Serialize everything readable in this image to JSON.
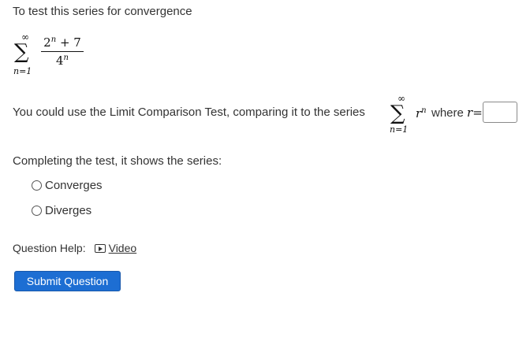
{
  "question": {
    "intro": "To test this series for convergence",
    "series": {
      "sum_upper": "∞",
      "sum_lower": "n=1",
      "numerator_base": "2",
      "numerator_exp": "n",
      "numerator_rest": " + 7",
      "denominator_base": "4",
      "denominator_exp": "n"
    },
    "comparison_text": "You could use the Limit Comparison Test, comparing it to the series",
    "comparison_series": {
      "sum_upper": "∞",
      "sum_lower": "n=1",
      "term_base": "r",
      "term_exp": "n"
    },
    "where_text": "where",
    "r_label": "r",
    "r_eq": "=",
    "r_input_value": "",
    "completing_text": "Completing the test, it shows the series:",
    "options": [
      "Converges",
      "Diverges"
    ]
  },
  "help": {
    "label": "Question Help:",
    "video_label": "Video"
  },
  "submit_label": "Submit Question"
}
